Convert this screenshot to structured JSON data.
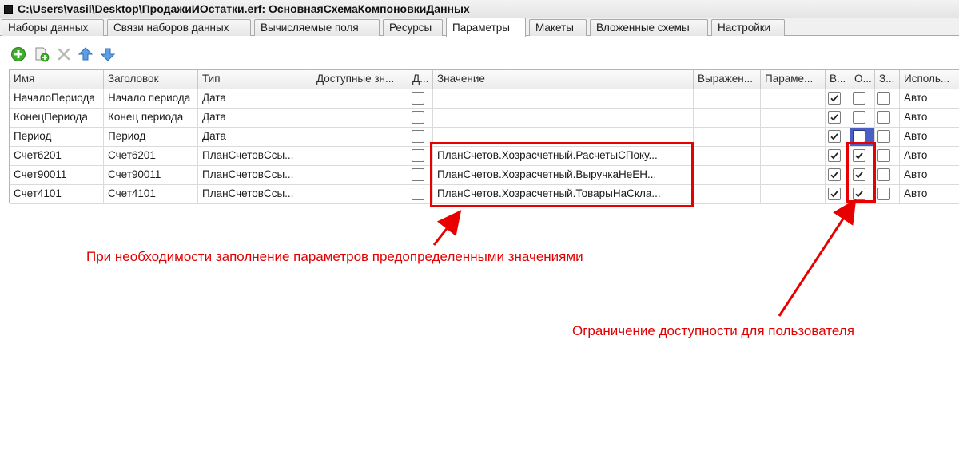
{
  "window": {
    "title": "C:\\Users\\vasil\\Desktop\\ПродажиИОстатки.erf: ОсновнаяСхемаКомпоновкиДанных"
  },
  "tabs": [
    {
      "label": "Наборы данных",
      "active": false
    },
    {
      "label": "Связи наборов данных",
      "active": false
    },
    {
      "label": "Вычисляемые поля",
      "active": false
    },
    {
      "label": "Ресурсы",
      "active": false
    },
    {
      "label": "Параметры",
      "active": true
    },
    {
      "label": "Макеты",
      "active": false
    },
    {
      "label": "Вложенные схемы",
      "active": false
    },
    {
      "label": "Настройки",
      "active": false
    }
  ],
  "toolbar": {
    "add_icon": "add-circle-icon",
    "copy_icon": "copy-add-icon",
    "delete_icon": "delete-x-icon",
    "up_icon": "arrow-up-icon",
    "down_icon": "arrow-down-icon"
  },
  "table": {
    "columns": [
      "Имя",
      "Заголовок",
      "Тип",
      "Доступные зн...",
      "Д...",
      "Значение",
      "Выражен...",
      "Параме...",
      "В...",
      "О...",
      "З...",
      "Исполь..."
    ],
    "rows": [
      {
        "name": "НачалоПериода",
        "title": "Начало периода",
        "type": "Дата",
        "available": "",
        "d": false,
        "value": "",
        "expr": "",
        "param": "",
        "v": true,
        "o": false,
        "z": false,
        "use": "Авто"
      },
      {
        "name": "КонецПериода",
        "title": "Конец периода",
        "type": "Дата",
        "available": "",
        "d": false,
        "value": "",
        "expr": "",
        "param": "",
        "v": true,
        "o": false,
        "z": false,
        "use": "Авто"
      },
      {
        "name": "Период",
        "title": "Период",
        "type": "Дата",
        "available": "",
        "d": false,
        "value": "",
        "expr": "",
        "param": "",
        "v": true,
        "o": false,
        "z": false,
        "use": "Авто"
      },
      {
        "name": "Счет6201",
        "title": "Счет6201",
        "type": "ПланСчетовСсы...",
        "available": "",
        "d": false,
        "value": "ПланСчетов.Хозрасчетный.РасчетыСПоку...",
        "expr": "",
        "param": "",
        "v": true,
        "o": true,
        "z": false,
        "use": "Авто"
      },
      {
        "name": "Счет90011",
        "title": "Счет90011",
        "type": "ПланСчетовСсы...",
        "available": "",
        "d": false,
        "value": "ПланСчетов.Хозрасчетный.ВыручкаНеЕН...",
        "expr": "",
        "param": "",
        "v": true,
        "o": true,
        "z": false,
        "use": "Авто"
      },
      {
        "name": "Счет4101",
        "title": "Счет4101",
        "type": "ПланСчетовСсы...",
        "available": "",
        "d": false,
        "value": "ПланСчетов.Хозрасчетный.ТоварыНаСкла...",
        "expr": "",
        "param": "",
        "v": true,
        "o": true,
        "z": false,
        "use": "Авто"
      }
    ]
  },
  "annotations": {
    "values_note": "При необходимости заполнение параметров предопределенными значениями",
    "restriction_note": "Ограничение доступности для пользователя",
    "color": "#e40000"
  },
  "colors": {
    "selection": "#4a5fc4",
    "highlight_box": "#e60000"
  }
}
